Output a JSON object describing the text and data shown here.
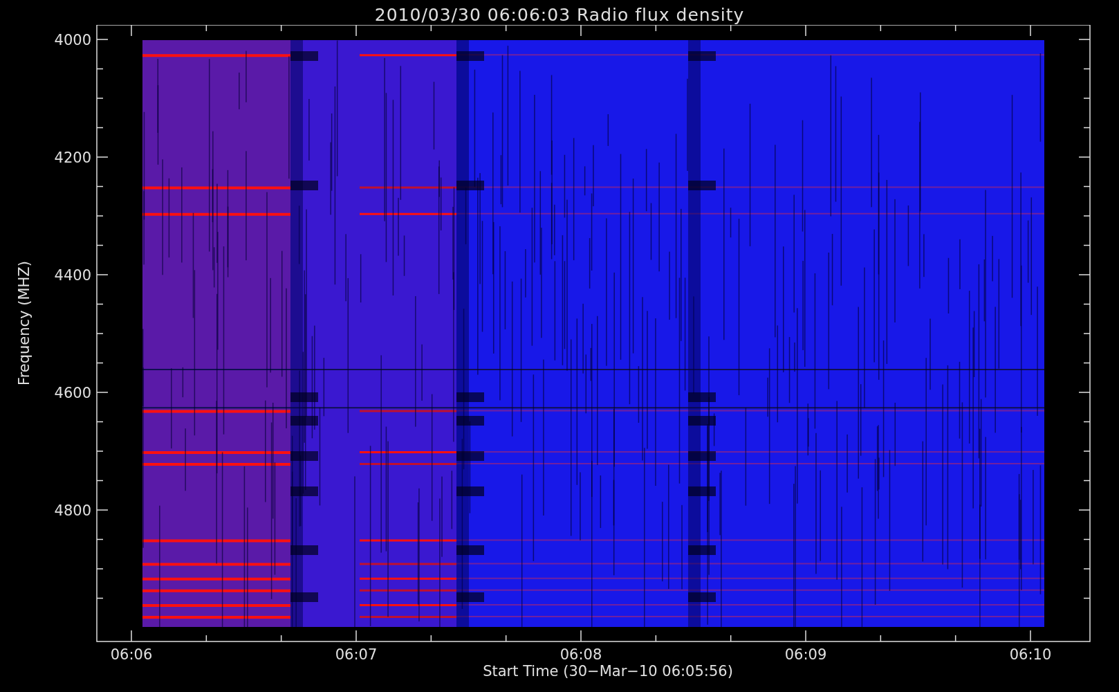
{
  "title": "2010/03/30 06:06:03 Radio flux density",
  "y_axis": {
    "label": "Frequency (MHZ)",
    "ticks": [
      "4000",
      "4200",
      "4400",
      "4600",
      "4800"
    ]
  },
  "x_axis": {
    "label": "Start Time (30−Mar−10 06:05:56)",
    "ticks": [
      "06:06",
      "06:07",
      "06:08",
      "06:09",
      "06:10"
    ]
  }
}
